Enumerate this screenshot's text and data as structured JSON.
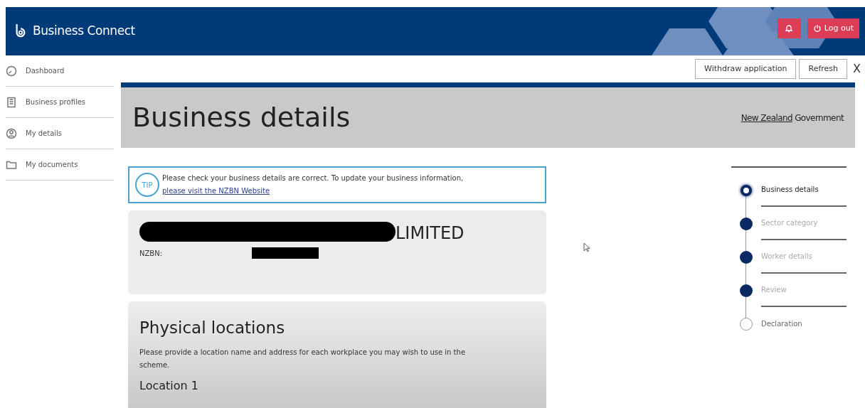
{
  "header": {
    "brand": "Business Connect",
    "logout_label": "Log out"
  },
  "sidebar": {
    "items": [
      {
        "label": "Dashboard",
        "kind": "dashboard",
        "selected": false
      },
      {
        "label": "Business profiles",
        "kind": "building",
        "selected": false
      },
      {
        "label": "My details",
        "kind": "person",
        "selected": false
      },
      {
        "label": "My documents",
        "kind": "folder",
        "selected": false
      }
    ]
  },
  "toolbar": {
    "buttons": [
      "Withdraw application",
      "Refresh"
    ],
    "close": "X"
  },
  "banner": {
    "title": "Business details",
    "government_parts": [
      "New Zealand",
      "Government"
    ]
  },
  "tip": {
    "badge": "TIP",
    "text": "Please check your business details are correct. To update your business information,",
    "link": "please visit the NZBN Website"
  },
  "business": {
    "name_suffix": "LIMITED",
    "nzbn_label": "NZBN:"
  },
  "locations": {
    "title": "Physical locations",
    "description": "Please provide a location name and address for each workplace you may wish to use in the scheme.",
    "location_title": "Location 1"
  },
  "steps": [
    {
      "label": "Business details",
      "kind": "current"
    },
    {
      "label": "Sector category",
      "kind": "complete"
    },
    {
      "label": "Worker details",
      "kind": "complete"
    },
    {
      "label": "Review",
      "kind": "complete"
    },
    {
      "label": "Declaration",
      "kind": "pending"
    }
  ]
}
